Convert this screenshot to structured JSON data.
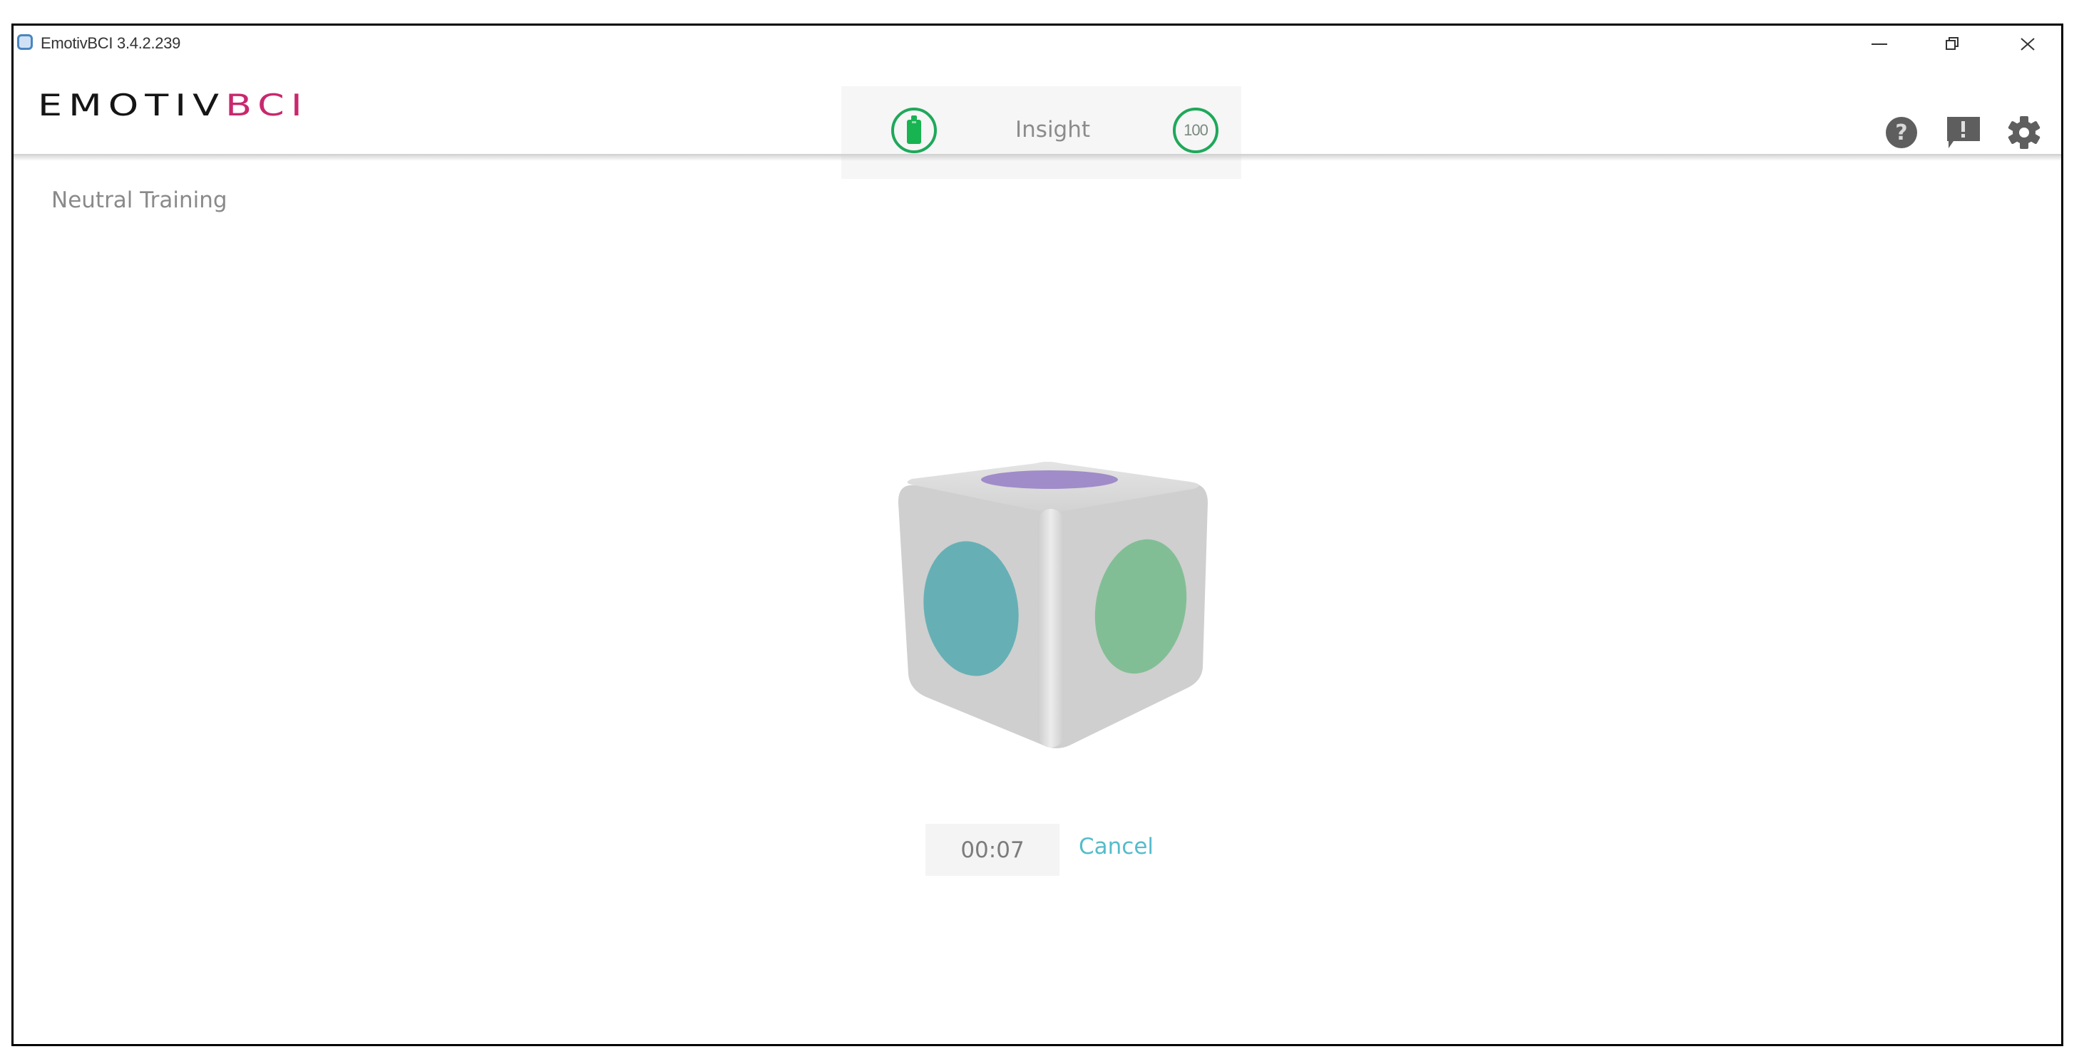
{
  "window": {
    "title": "EmotivBCI 3.4.2.239",
    "controls": [
      "minimize",
      "restore",
      "close"
    ]
  },
  "header": {
    "logo_primary": "EMOTIV",
    "logo_accent": "BCI",
    "logo_accent_color": "#c8286e",
    "device": {
      "name": "Insight",
      "battery_icon": "battery-icon",
      "battery_status_color": "#18b452",
      "signal_quality": "100"
    },
    "icons": [
      "help-icon",
      "feedback-icon",
      "settings-icon"
    ]
  },
  "main": {
    "page_title": "Neutral Training",
    "cube": {
      "faces": [
        {
          "face": "top",
          "color": "#a08cc8"
        },
        {
          "face": "left",
          "color": "#66b0b5"
        },
        {
          "face": "right",
          "color": "#82be95"
        }
      ]
    },
    "timer": "00:07",
    "cancel_label": "Cancel",
    "accent_color": "#55bccb"
  }
}
